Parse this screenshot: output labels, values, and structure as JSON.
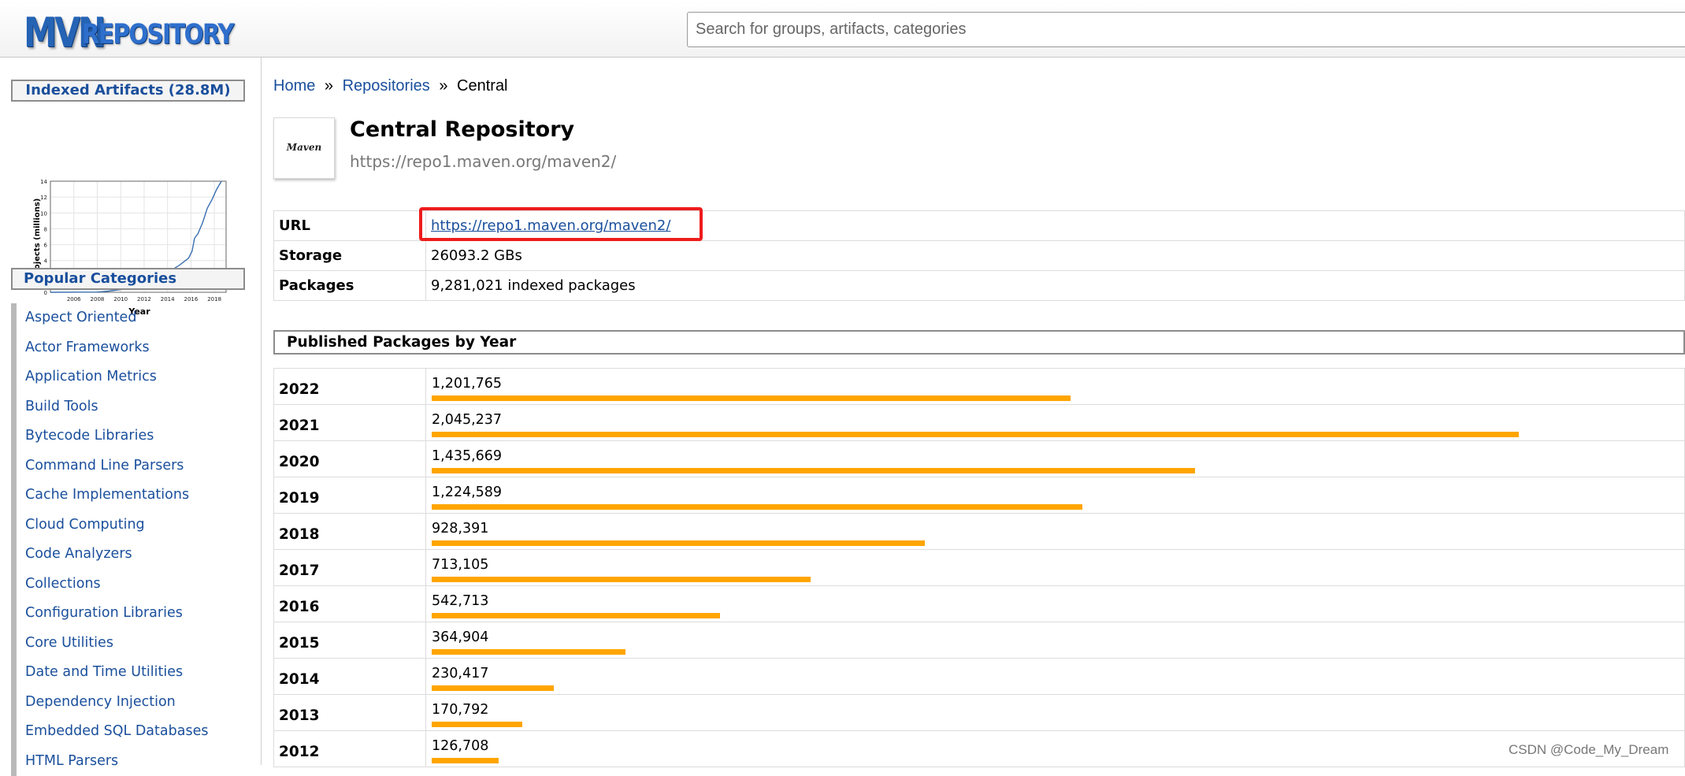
{
  "header": {
    "logo_part1": "MVN",
    "logo_part2": "REPOSITORY",
    "search_placeholder": "Search for groups, artifacts, categories"
  },
  "sidebar": {
    "indexed_label": "Indexed Artifacts (28.8M)",
    "chart": {
      "ylabel": "Projects (millions)",
      "xlabel": "Year",
      "yticks": [
        "0",
        "2",
        "4",
        "6",
        "8",
        "10",
        "12",
        "14"
      ],
      "xticks": [
        "2006",
        "2008",
        "2010",
        "2012",
        "2014",
        "2016",
        "2018"
      ],
      "series": [
        [
          2004.0,
          0
        ],
        [
          2008,
          0.03
        ],
        [
          2009,
          0.15
        ],
        [
          2010,
          0.35
        ],
        [
          2011,
          0.7
        ],
        [
          2012,
          1.1
        ],
        [
          2013,
          1.7
        ],
        [
          2014,
          2.5
        ],
        [
          2015,
          3.4
        ],
        [
          2015.8,
          4.3
        ],
        [
          2016.1,
          5.2
        ],
        [
          2016.3,
          6.8
        ],
        [
          2016.6,
          7.4
        ],
        [
          2017,
          8.8
        ],
        [
          2017.4,
          10.6
        ],
        [
          2017.8,
          11.7
        ],
        [
          2018.2,
          13.0
        ],
        [
          2018.6,
          14.0
        ]
      ]
    },
    "categories_label": "Popular Categories",
    "categories": [
      "Aspect Oriented",
      "Actor Frameworks",
      "Application Metrics",
      "Build Tools",
      "Bytecode Libraries",
      "Command Line Parsers",
      "Cache Implementations",
      "Cloud Computing",
      "Code Analyzers",
      "Collections",
      "Configuration Libraries",
      "Core Utilities",
      "Date and Time Utilities",
      "Dependency Injection",
      "Embedded SQL Databases",
      "HTML Parsers"
    ]
  },
  "breadcrumb": {
    "home": "Home",
    "separator": "»",
    "repositories": "Repositories",
    "current": "Central"
  },
  "repo": {
    "logo_text": "Maven",
    "title": "Central Repository",
    "url": "https://repo1.maven.org/maven2/"
  },
  "info": {
    "url_label": "URL",
    "url_value": "https://repo1.maven.org/maven2/",
    "storage_label": "Storage",
    "storage_value": "26093.2 GBs",
    "packages_label": "Packages",
    "packages_value": "9,281,021 indexed packages"
  },
  "published": {
    "title": "Published Packages by Year",
    "rows": [
      {
        "year": "2022",
        "count": "1,201,765"
      },
      {
        "year": "2021",
        "count": "2,045,237"
      },
      {
        "year": "2020",
        "count": "1,435,669"
      },
      {
        "year": "2019",
        "count": "1,224,589"
      },
      {
        "year": "2018",
        "count": "928,391"
      },
      {
        "year": "2017",
        "count": "713,105"
      },
      {
        "year": "2016",
        "count": "542,713"
      },
      {
        "year": "2015",
        "count": "364,904"
      },
      {
        "year": "2014",
        "count": "230,417"
      },
      {
        "year": "2013",
        "count": "170,792"
      },
      {
        "year": "2012",
        "count": "126,708"
      }
    ]
  },
  "colors": {
    "link": "#1a4f9c",
    "bar": "#ffa500",
    "highlight": "#ee1c1c"
  },
  "watermark": "CSDN @Code_My_Dream"
}
